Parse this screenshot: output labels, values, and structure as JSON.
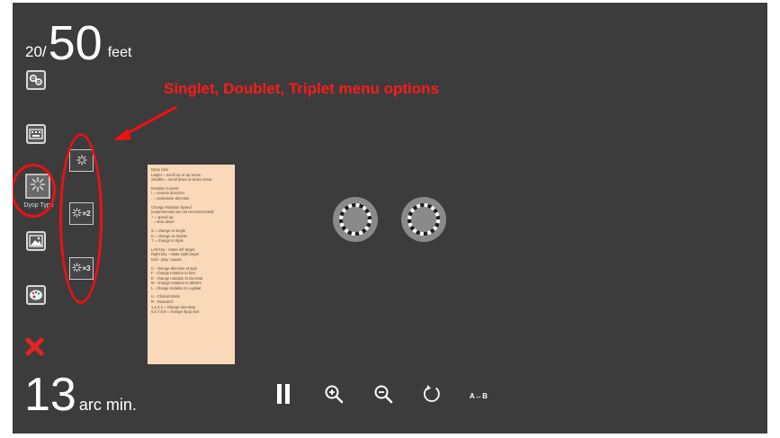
{
  "acuity": {
    "top_prefix": "20/",
    "top_value": "50",
    "top_unit": "feet",
    "bottom_value": "13",
    "bottom_unit": "arc min."
  },
  "sidebar": {
    "settings_icon": "gear-icon",
    "keyboard_icon": "keyboard-icon",
    "dyop_type_label": "Dyop Type",
    "dyop_type_icon": "starburst-icon",
    "image_icon": "image-icon",
    "palette_icon": "palette-icon",
    "close_icon": "close-icon",
    "close_color": "#e52222"
  },
  "dyop_menu": {
    "singlet_icon": "starburst-icon",
    "doublet_suffix": "×2",
    "triplet_suffix": "×3"
  },
  "annotation": {
    "text": "Singlet, Doublet, Triplet menu options",
    "color": "#ee1111"
  },
  "help_panel": {
    "lines": [
      "Dyop Size",
      "Larger = scroll up or up arrow",
      "Smaller = scroll down or down arrow",
      "",
      "Rotation Control",
      "/ = reverse direction",
      ". = randomize direction",
      "",
      "Change Rotation Speed",
      "(experimental use not recommended)",
      "+ = speed up",
      "- = slow down",
      "",
      "S = change to single",
      "D = change to double",
      "T = change to triple",
      "",
      "Left Key - rotate left target",
      "Right key - rotate right target",
      "End - play / pause",
      "",
      "C - change direction of spin",
      "F - change notation to feet",
      "E - change notation to Decimal",
      "M - change notation to Meters",
      "L - change notation to LogMar",
      "",
      "U - Clinical Mode",
      "R - Research",
      "1,2,3,4 = change size step",
      "5,6,7,8,9 = change dyop size"
    ]
  },
  "controls": {
    "pause_icon": "pause-icon",
    "zoom_in_icon": "zoom-in-icon",
    "zoom_out_icon": "zoom-out-icon",
    "rotate_icon": "rotate-icon",
    "ab_label": "A↔B"
  },
  "colors": {
    "background": "#3c3c3c",
    "panel": "#f9d9b9",
    "dyop_ring": "#8a8a8a"
  }
}
